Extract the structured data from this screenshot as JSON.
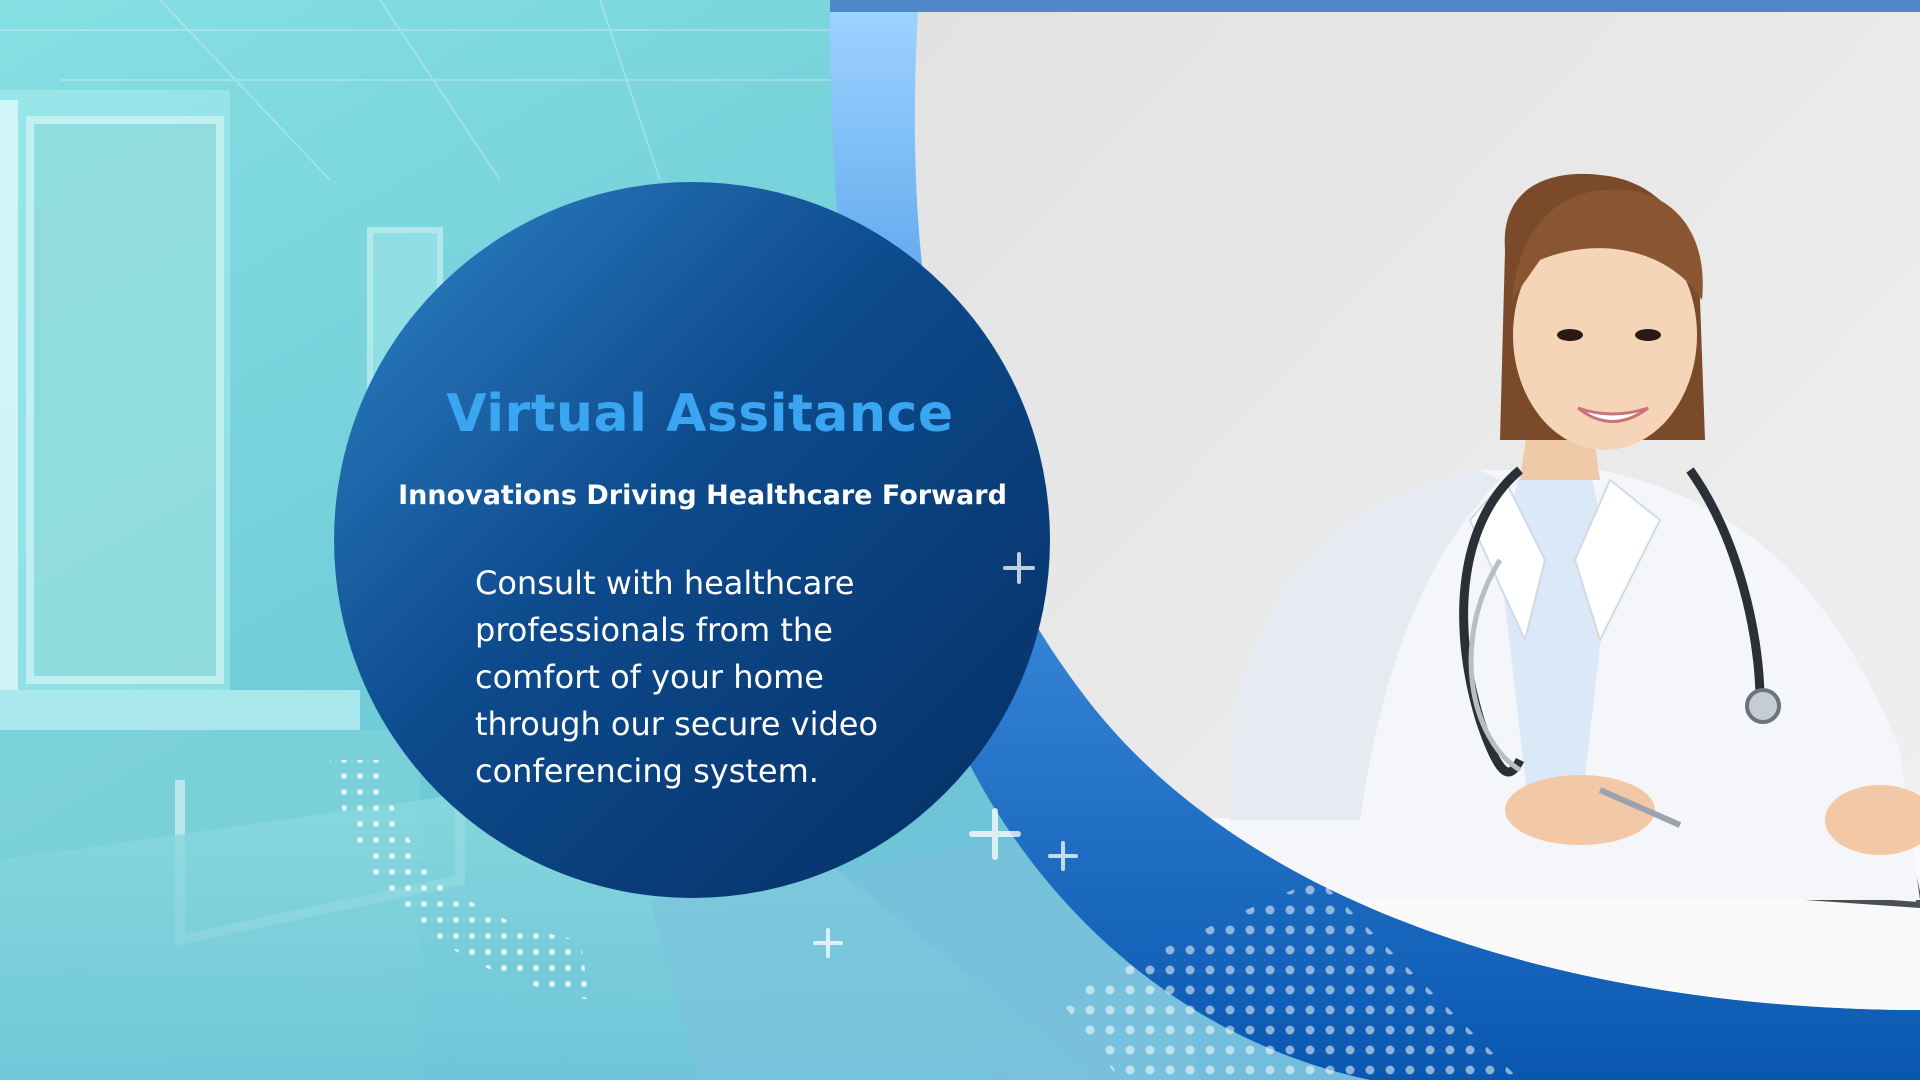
{
  "hero": {
    "title": "Virtual Assitance",
    "subtitle": "Innovations Driving Healthcare Forward",
    "description": "Consult with healthcare professionals from the comfort of your home through our secure video conferencing system."
  },
  "colors": {
    "title_accent": "#3aa6f2",
    "circle_dark": "#0a3d7a",
    "circle_light": "#2d7ec4",
    "swoosh_blue": "#0b5fb8",
    "teal_background": "#6fd0d9"
  },
  "icons": [
    "plus-icon",
    "dot-pattern",
    "doctor-photo",
    "hospital-corridor-photo"
  ]
}
